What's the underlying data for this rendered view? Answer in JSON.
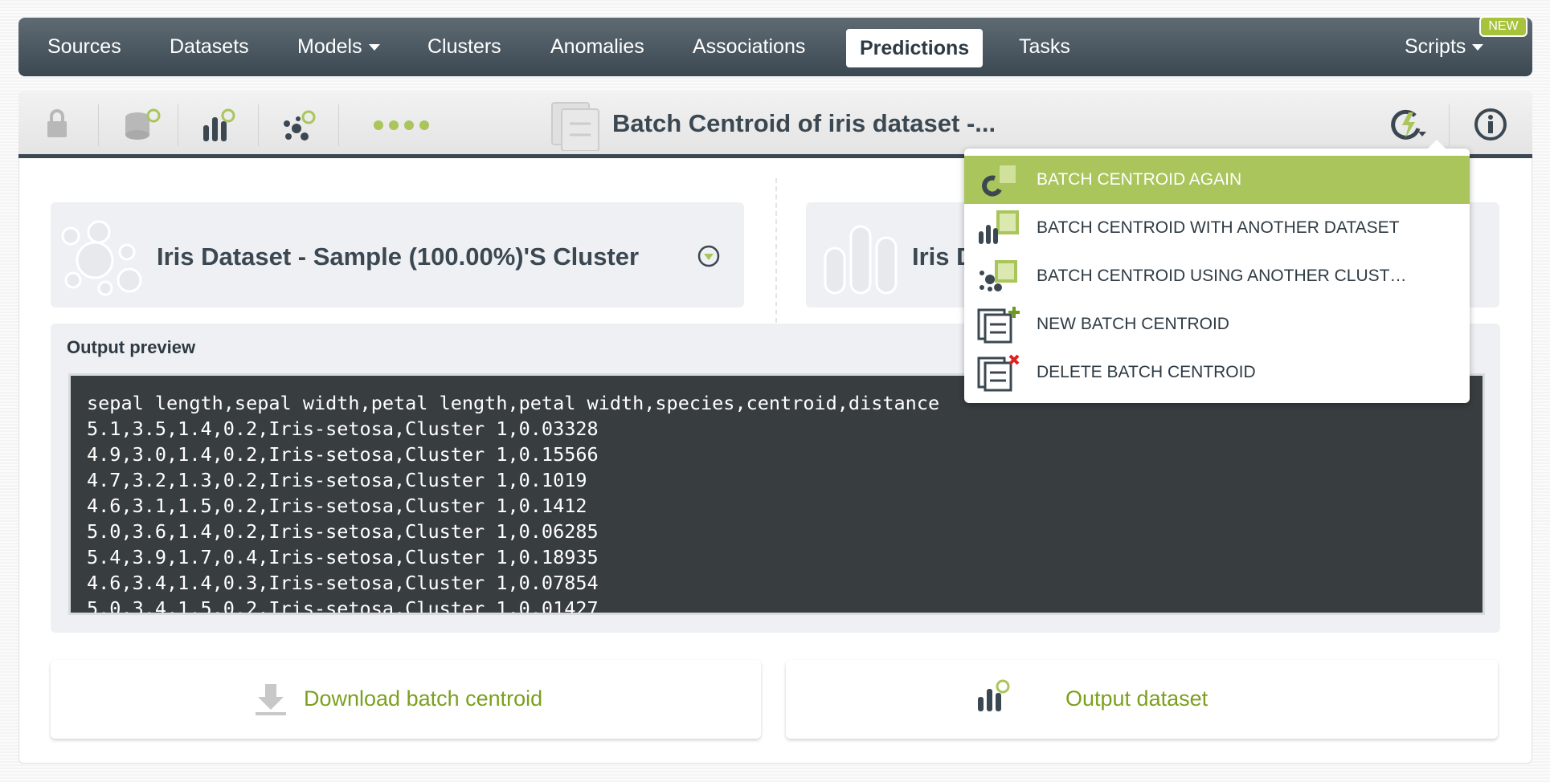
{
  "nav": {
    "items": [
      {
        "label": "Sources"
      },
      {
        "label": "Datasets"
      },
      {
        "label": "Models"
      },
      {
        "label": "Clusters"
      },
      {
        "label": "Anomalies"
      },
      {
        "label": "Associations"
      },
      {
        "label": "Predictions"
      },
      {
        "label": "Tasks"
      },
      {
        "label": "Scripts"
      }
    ],
    "new_badge": "NEW",
    "active": "Predictions"
  },
  "toolbar": {
    "title": "Batch Centroid of iris dataset -..."
  },
  "cards": {
    "cluster": "Iris Dataset - Sample (100.00%)'S Cluster",
    "dataset": "Iris D"
  },
  "output": {
    "label": "Output preview",
    "lines": [
      "sepal length,sepal width,petal length,petal width,species,centroid,distance",
      "5.1,3.5,1.4,0.2,Iris-setosa,Cluster 1,0.03328",
      "4.9,3.0,1.4,0.2,Iris-setosa,Cluster 1,0.15566",
      "4.7,3.2,1.3,0.2,Iris-setosa,Cluster 1,0.1019",
      "4.6,3.1,1.5,0.2,Iris-setosa,Cluster 1,0.1412",
      "5.0,3.6,1.4,0.2,Iris-setosa,Cluster 1,0.06285",
      "5.4,3.9,1.7,0.4,Iris-setosa,Cluster 1,0.18935",
      "4.6,3.4,1.4,0.3,Iris-setosa,Cluster 1,0.07854",
      "5.0,3.4,1.5,0.2,Iris-setosa,Cluster 1,0.01427"
    ]
  },
  "buttons": {
    "download": "Download batch centroid",
    "output_dataset": "Output dataset"
  },
  "menu": {
    "items": [
      {
        "label": "BATCH CENTROID AGAIN",
        "icon": "rerun-icon"
      },
      {
        "label": "BATCH CENTROID WITH ANOTHER DATASET",
        "icon": "dataset-icon"
      },
      {
        "label": "BATCH CENTROID USING ANOTHER CLUST…",
        "icon": "cluster-icon"
      },
      {
        "label": "NEW BATCH CENTROID",
        "icon": "new-icon"
      },
      {
        "label": "DELETE BATCH CENTROID",
        "icon": "delete-icon"
      }
    ]
  },
  "colors": {
    "accent": "#a9c55b",
    "nav": "#3b4852",
    "link": "#7ba01e"
  }
}
